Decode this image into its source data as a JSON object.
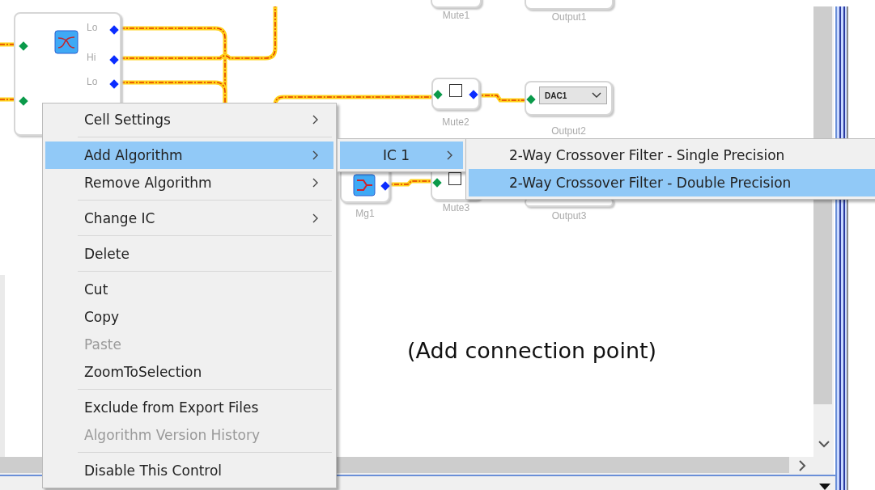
{
  "canvas": {
    "blocks": [
      {
        "kind": "crossover",
        "ports": [
          "Lo",
          "Hi",
          "Lo"
        ]
      },
      {
        "kind": "mute",
        "label": "Mute1"
      },
      {
        "kind": "output",
        "label": "Output1"
      },
      {
        "kind": "mute",
        "label": "Mute2",
        "checked": false
      },
      {
        "kind": "output",
        "label": "Output2",
        "value": "DAC1"
      },
      {
        "kind": "merge",
        "label": "Mg1"
      },
      {
        "kind": "mute",
        "label": "Mute3",
        "checked": false
      },
      {
        "kind": "output",
        "label": "Output3"
      }
    ],
    "annotation": "(Add connection point)"
  },
  "context_menu": {
    "items": [
      {
        "kind": "item",
        "label": "Cell Settings",
        "submenu": true,
        "selected": false,
        "disabled": false
      },
      {
        "kind": "separator"
      },
      {
        "kind": "item",
        "label": "Add Algorithm",
        "submenu": true,
        "selected": true,
        "disabled": false
      },
      {
        "kind": "item",
        "label": "Remove Algorithm",
        "submenu": true,
        "selected": false,
        "disabled": false
      },
      {
        "kind": "separator"
      },
      {
        "kind": "item",
        "label": "Change IC",
        "submenu": true,
        "selected": false,
        "disabled": false
      },
      {
        "kind": "separator"
      },
      {
        "kind": "item",
        "label": "Delete",
        "submenu": false,
        "selected": false,
        "disabled": false
      },
      {
        "kind": "separator"
      },
      {
        "kind": "item",
        "label": "Cut",
        "submenu": false,
        "selected": false,
        "disabled": false
      },
      {
        "kind": "item",
        "label": "Copy",
        "submenu": false,
        "selected": false,
        "disabled": false
      },
      {
        "kind": "item",
        "label": "Paste",
        "submenu": false,
        "selected": false,
        "disabled": true
      },
      {
        "kind": "item",
        "label": "ZoomToSelection",
        "submenu": false,
        "selected": false,
        "disabled": false
      },
      {
        "kind": "separator"
      },
      {
        "kind": "item",
        "label": "Exclude from Export Files",
        "submenu": false,
        "selected": false,
        "disabled": false
      },
      {
        "kind": "item",
        "label": "Algorithm Version History",
        "submenu": false,
        "selected": false,
        "disabled": true
      },
      {
        "kind": "separator"
      },
      {
        "kind": "item",
        "label": "Disable This Control",
        "submenu": false,
        "selected": false,
        "disabled": false
      }
    ]
  },
  "ic_submenu": {
    "items": [
      {
        "label": "IC 1",
        "submenu": true,
        "selected": true
      }
    ]
  },
  "algorithm_submenu": {
    "items": [
      {
        "label": "2-Way Crossover Filter - Single Precision",
        "selected": false
      },
      {
        "label": "2-Way Crossover Filter - Double Precision",
        "selected": true
      }
    ]
  }
}
